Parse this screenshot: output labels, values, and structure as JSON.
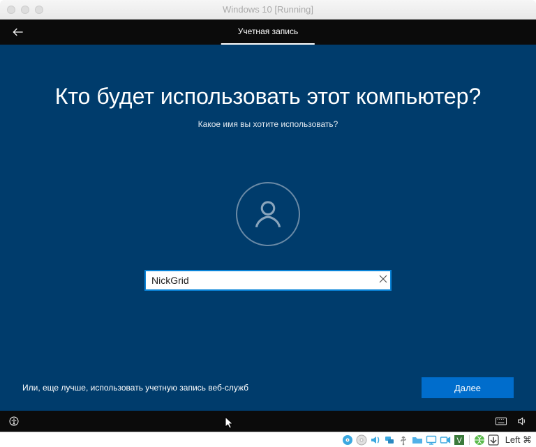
{
  "window": {
    "title": "Windows 10 [Running]"
  },
  "header": {
    "tab": "Учетная запись"
  },
  "main": {
    "heading": "Кто будет использовать этот компьютер?",
    "subheading": "Какое имя вы хотите использовать?",
    "name_input_value": "NickGrid",
    "alt_link": "Или, еще лучше, использовать учетную запись веб-служб",
    "next_label": "Далее"
  },
  "vbox": {
    "hostkey": "Left ⌘"
  }
}
